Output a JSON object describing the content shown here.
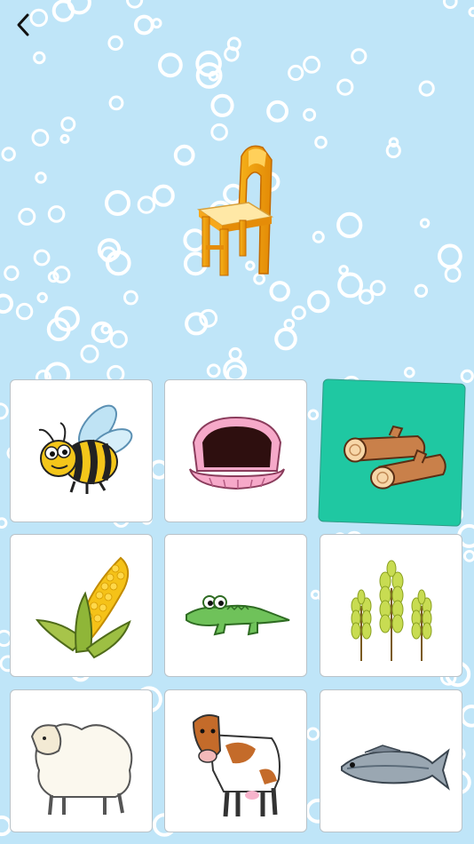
{
  "header": {
    "back_icon": "chevron-left-icon"
  },
  "prompt": {
    "icon": "chair-image"
  },
  "options": [
    {
      "icon": "bee-image",
      "selected": false
    },
    {
      "icon": "clam-shell-image",
      "selected": false
    },
    {
      "icon": "wood-logs-image",
      "selected": true
    },
    {
      "icon": "corn-image",
      "selected": false
    },
    {
      "icon": "crocodile-image",
      "selected": false
    },
    {
      "icon": "wheat-image",
      "selected": false
    },
    {
      "icon": "sheep-image",
      "selected": false
    },
    {
      "icon": "cow-image",
      "selected": false
    },
    {
      "icon": "fish-image",
      "selected": false
    }
  ],
  "colors": {
    "background": "#bfe5f8",
    "bubble": "#ffffff",
    "selected_card": "#1fc8a2",
    "card": "#ffffff"
  }
}
